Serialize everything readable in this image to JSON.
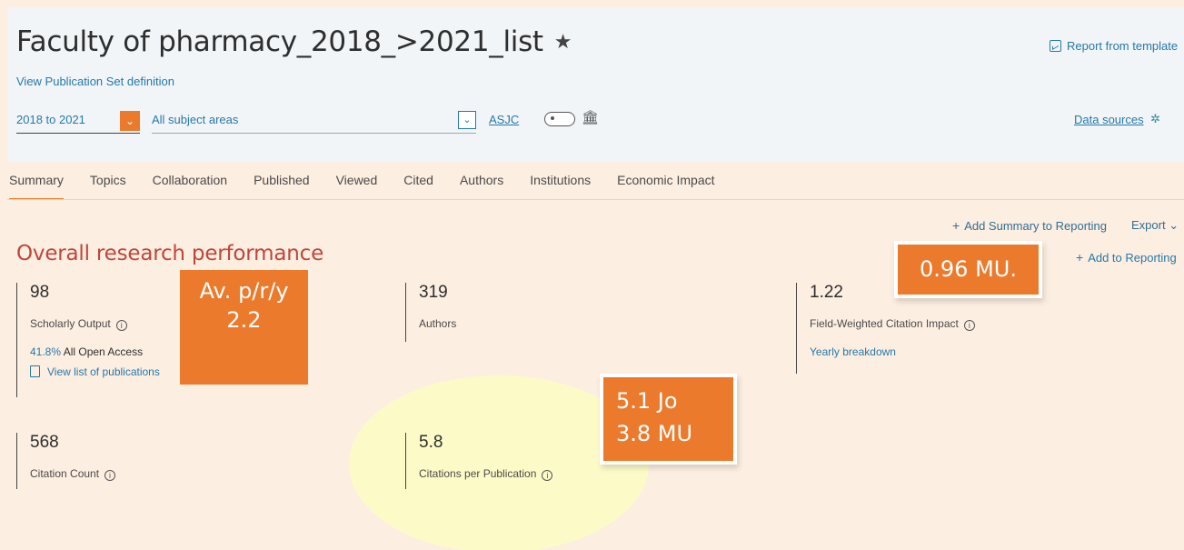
{
  "header": {
    "title": "Faculty of pharmacy_2018_>2021_list",
    "star": "★",
    "view_definition": "View Publication Set definition",
    "report_from_template": "Report from template",
    "year_range": "2018 to 2021",
    "subject_areas": "All subject areas",
    "asjc": "ASJC",
    "data_sources": "Data sources"
  },
  "tabs": [
    {
      "label": "Summary"
    },
    {
      "label": "Topics"
    },
    {
      "label": "Collaboration"
    },
    {
      "label": "Published"
    },
    {
      "label": "Viewed"
    },
    {
      "label": "Cited"
    },
    {
      "label": "Authors"
    },
    {
      "label": "Institutions"
    },
    {
      "label": "Economic Impact"
    }
  ],
  "actions": {
    "add_summary": "Add Summary to Reporting",
    "export": "Export",
    "add_reporting": "Add to Reporting"
  },
  "section_title": "Overall research performance",
  "metrics": {
    "scholarly_output": {
      "value": "98",
      "label": "Scholarly Output",
      "open_access_pct": "41.8%",
      "open_access_label": "All Open Access",
      "view_list": "View list of publications"
    },
    "authors": {
      "value": "319",
      "label": "Authors"
    },
    "fwci": {
      "value": "1.22",
      "label": "Field-Weighted Citation Impact",
      "yearly": "Yearly breakdown"
    },
    "citation_count": {
      "value": "568",
      "label": "Citation Count"
    },
    "citations_per_pub": {
      "value": "5.8",
      "label": "Citations per Publication"
    }
  },
  "annotations": {
    "avg_line1": "Av. p/r/y",
    "avg_line2": "2.2",
    "mu": "0.96 MU.",
    "jo_line1": "5.1 Jo",
    "jo_line2": "3.8 MU"
  },
  "colors": {
    "accent_orange": "#ec7a2c",
    "link_blue": "#2579a9",
    "section_red": "#c0463a",
    "background": "#fdeee2",
    "header_bg": "#f1f5f8",
    "highlight_yellow": "#fcfbc8"
  }
}
